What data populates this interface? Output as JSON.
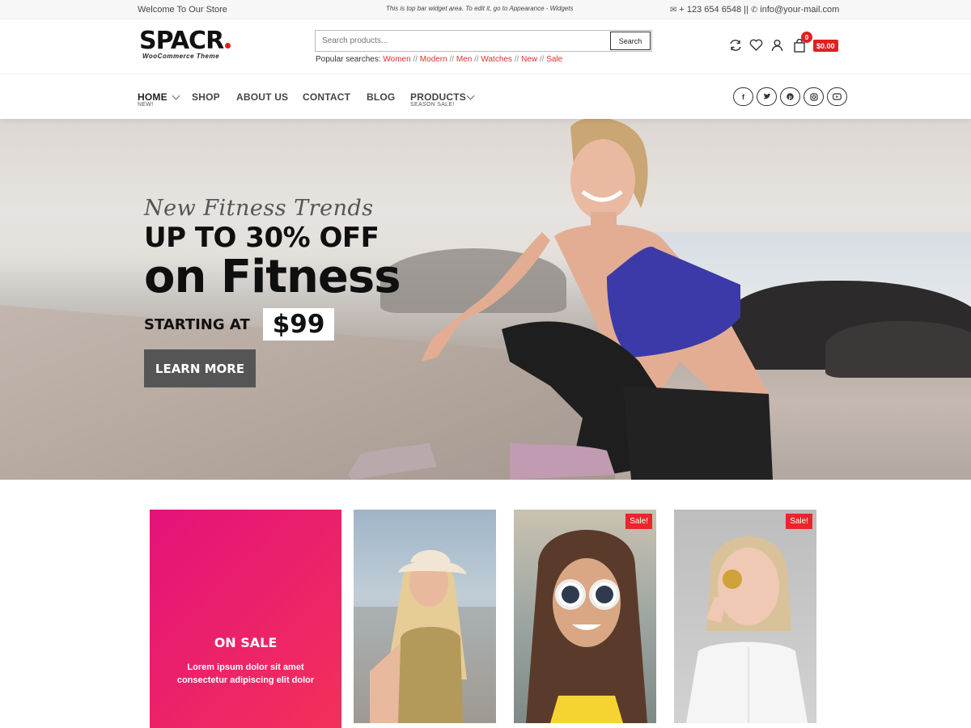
{
  "topbar": {
    "welcome": "Welcome To Our Store",
    "widget_text": "This is top bar widget area. To edit it, go to Appearance - Widgets",
    "phone": "+ 123 654 6548",
    "separator": "||",
    "email": "info@your-mail.com"
  },
  "header": {
    "logo_name": "SPACR",
    "logo_tagline": "WooCommerce Theme",
    "search_placeholder": "Search products...",
    "search_button": "Search",
    "popular_label": "Popular searches:",
    "popular_tags": [
      "Women",
      "Modern",
      "Men",
      "Watches",
      "New",
      "Sale"
    ],
    "tag_separator": "//",
    "cart_count": "0",
    "cart_total": "$0.00"
  },
  "nav": {
    "items": [
      {
        "label": "HOME",
        "sub": "NEW!"
      },
      {
        "label": "SHOP",
        "sub": ""
      },
      {
        "label": "ABOUT US",
        "sub": ""
      },
      {
        "label": "CONTACT",
        "sub": ""
      },
      {
        "label": "BLOG",
        "sub": ""
      },
      {
        "label": "PRODUCTS",
        "sub": "SEASON SALE!"
      }
    ],
    "socials": [
      "facebook-icon",
      "twitter-icon",
      "pinterest-icon",
      "instagram-icon",
      "youtube-icon"
    ]
  },
  "hero": {
    "script": "New Fitness Trends",
    "line1": "UP TO 30% OFF",
    "line2": "on Fitness",
    "starting_label": "STARTING AT",
    "price": "$99",
    "button": "LEARN MORE"
  },
  "products": {
    "promo_title": "ON SALE",
    "promo_desc": "Lorem ipsum dolor sit amet consectetur adipiscing elit dolor",
    "sale_badge": "Sale!"
  },
  "colors": {
    "accent_red": "#e02020",
    "promo_pink": "#e4127a",
    "button_gray": "#555555"
  }
}
